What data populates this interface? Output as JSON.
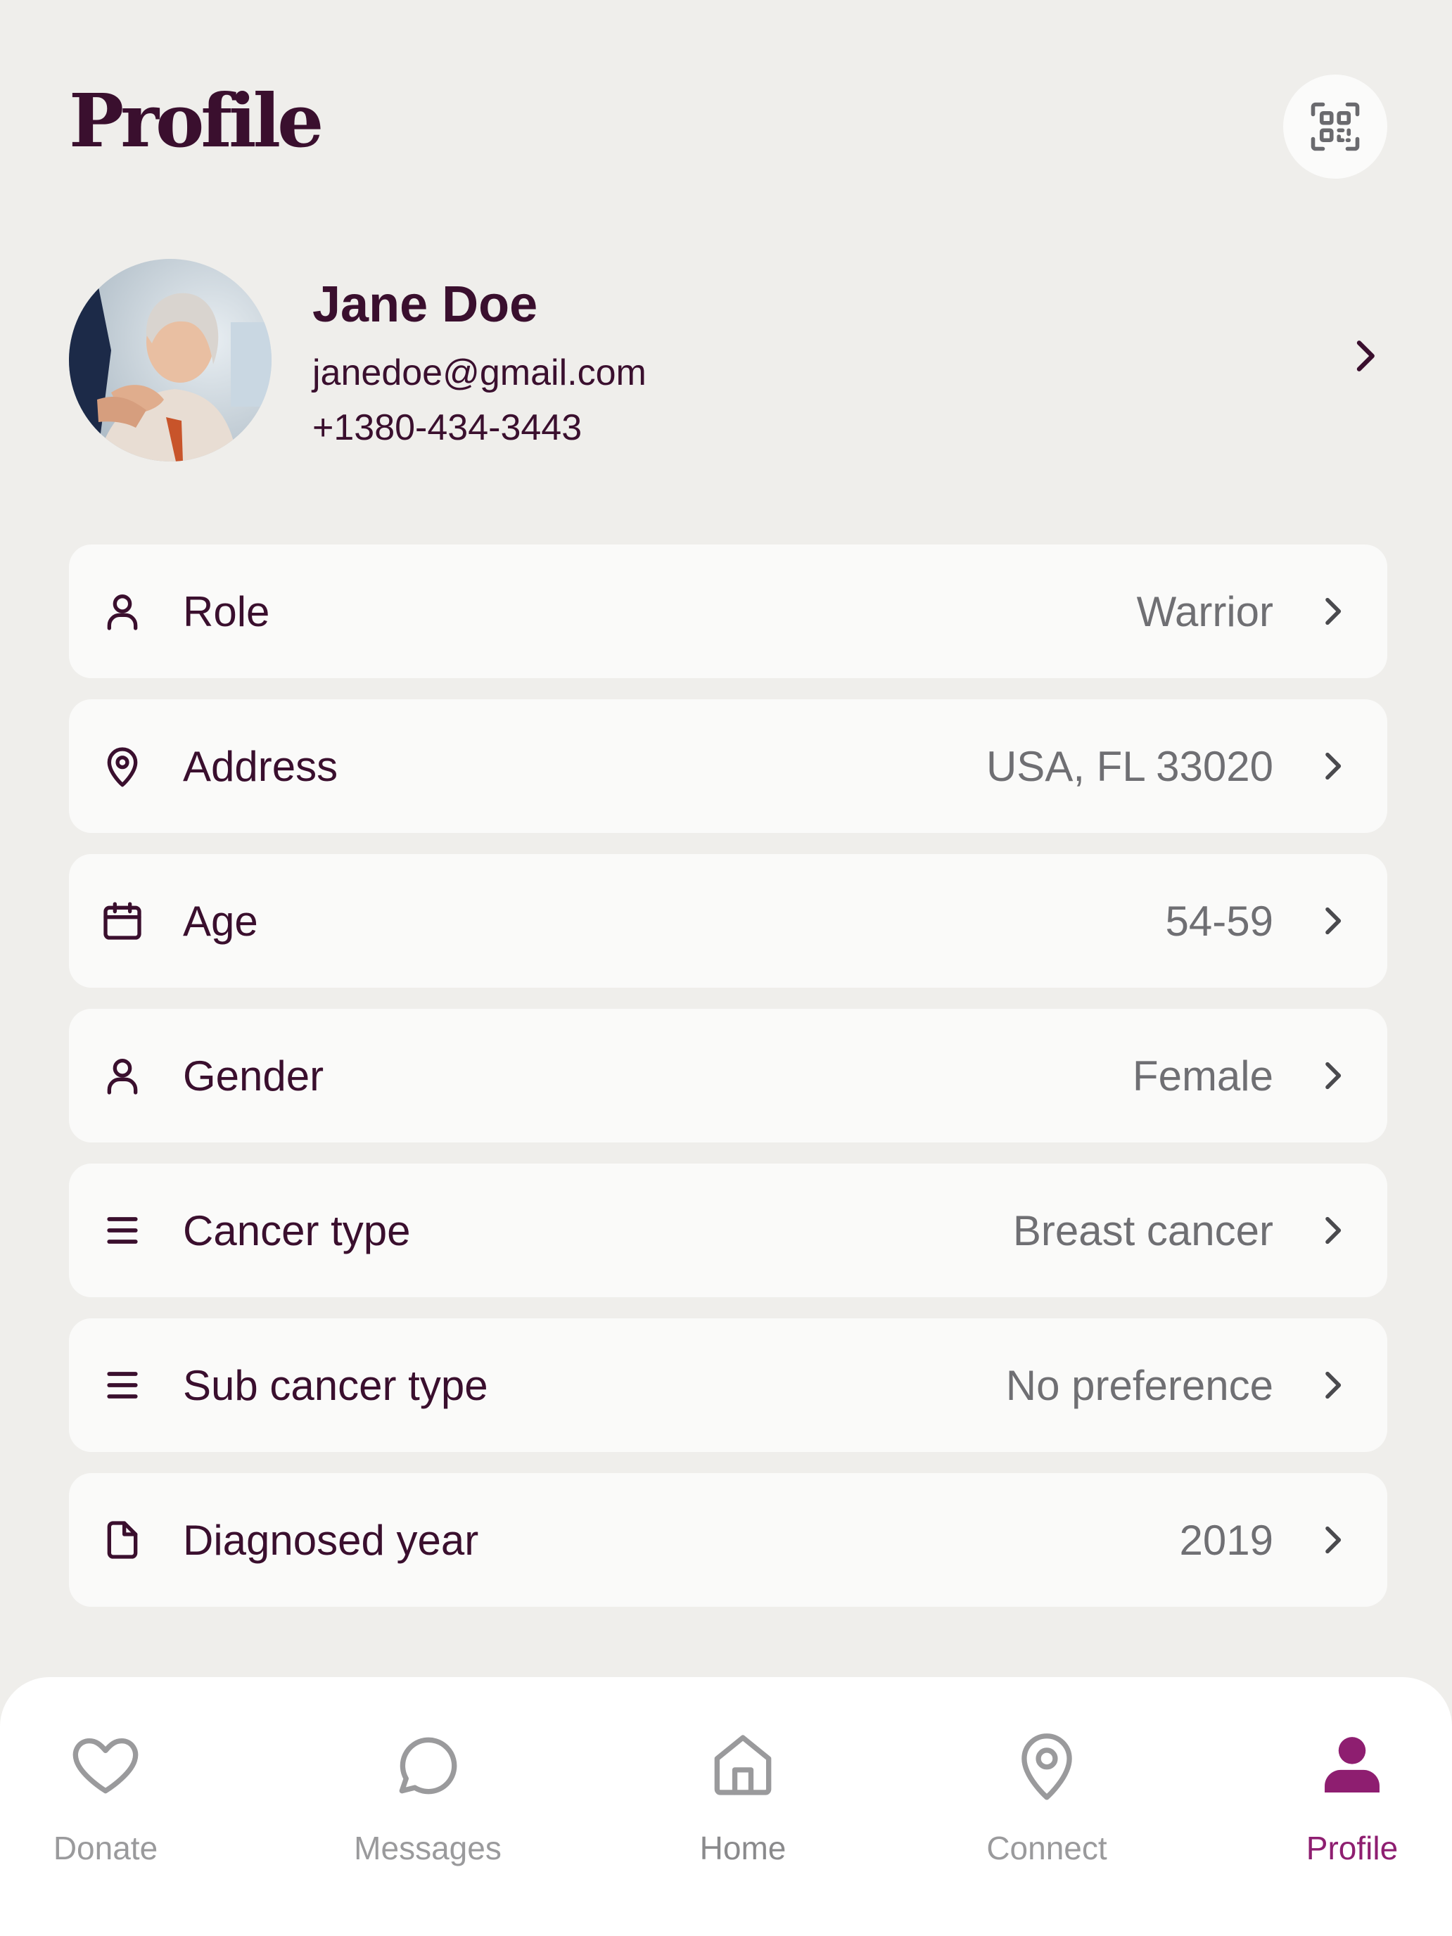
{
  "header": {
    "title": "Profile",
    "qr_icon": "qr-code-icon"
  },
  "user": {
    "name": "Jane Doe",
    "email": "janedoe@gmail.com",
    "phone": "+1380-434-3443"
  },
  "rows": [
    {
      "icon": "user-icon",
      "label": "Role",
      "value": "Warrior"
    },
    {
      "icon": "location-pin-icon",
      "label": "Address",
      "value": "USA, FL 33020"
    },
    {
      "icon": "calendar-icon",
      "label": "Age",
      "value": "54-59"
    },
    {
      "icon": "user-icon",
      "label": "Gender",
      "value": "Female"
    },
    {
      "icon": "list-icon",
      "label": "Cancer type",
      "value": "Breast cancer"
    },
    {
      "icon": "list-icon",
      "label": "Sub cancer type",
      "value": "No preference"
    },
    {
      "icon": "document-icon",
      "label": "Diagnosed year",
      "value": "2019"
    }
  ],
  "nav": {
    "items": [
      {
        "icon": "heart-icon",
        "label": "Donate"
      },
      {
        "icon": "chat-bubble-icon",
        "label": "Messages"
      },
      {
        "icon": "home-icon",
        "label": "Home"
      },
      {
        "icon": "location-pin-icon",
        "label": "Connect"
      },
      {
        "icon": "user-icon",
        "label": "Profile"
      }
    ],
    "active": "Profile"
  },
  "colors": {
    "primary": "#3a0f2e",
    "accent": "#8e1e70",
    "muted": "#9a9a9c",
    "value_text": "#6f6f73",
    "background": "#efeeeb",
    "card": "#fafaf9"
  }
}
